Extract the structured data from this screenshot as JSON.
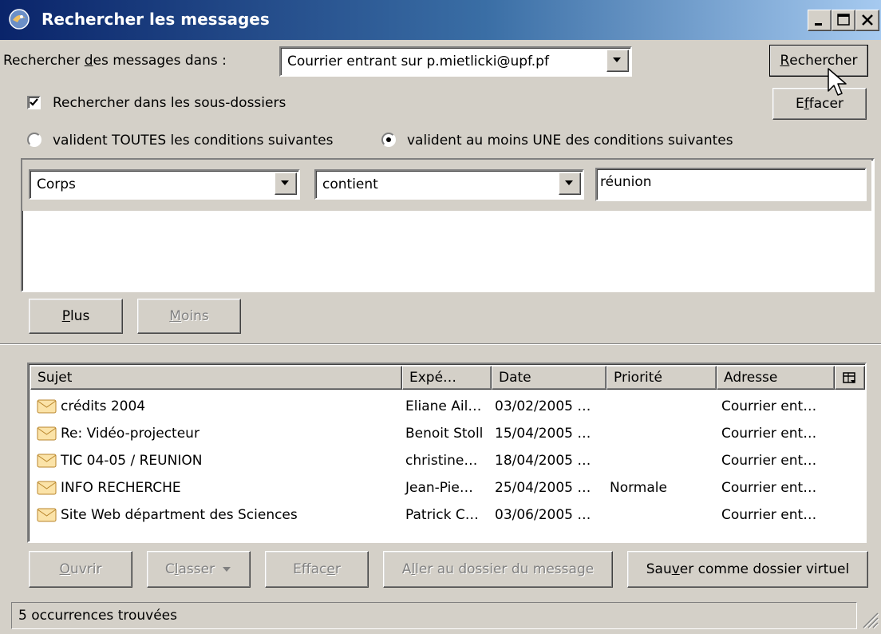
{
  "window": {
    "title": "Rechercher les messages",
    "icon": "thunderbird-icon"
  },
  "search": {
    "folder_label_before": "Rechercher ",
    "folder_label_mnemonic": "d",
    "folder_label_after": "es messages dans :",
    "folder_value": "Courrier entrant sur p.mietlicki@upf.pf",
    "search_button_before": "",
    "search_button_mnemonic": "R",
    "search_button_after": "echercher",
    "clear_button_before": "E",
    "clear_button_mnemonic": "f",
    "clear_button_after": "facer",
    "subfolders_label": "Rechercher dans les sous-dossiers",
    "subfolders_checked": true,
    "match_all_label": "valident TOUTES les conditions suivantes",
    "match_any_label": "valident au moins UNE des conditions suivantes",
    "selected_match": "any"
  },
  "criteria": {
    "field": "Corps",
    "operator": "contient",
    "value": "réunion",
    "more_mnemonic": "P",
    "more_rest": "lus",
    "less_mnemonic": "M",
    "less_rest": "oins"
  },
  "results": {
    "columns": [
      "Sujet",
      "Expé…",
      "Date",
      "Priorité",
      "Adresse"
    ],
    "rows": [
      {
        "subject": "crédits 2004",
        "sender": "Eliane Ail…",
        "date": "03/02/2005 …",
        "priority": "",
        "account": "Courrier ent…"
      },
      {
        "subject": "Re: Vidéo-projecteur",
        "sender": "Benoit Stoll",
        "date": "15/04/2005 …",
        "priority": "",
        "account": "Courrier ent…"
      },
      {
        "subject": "TIC 04-05 / REUNION",
        "sender": "christine…",
        "date": "18/04/2005 …",
        "priority": "",
        "account": "Courrier ent…"
      },
      {
        "subject": "INFO RECHERCHE",
        "sender": "Jean-Pie…",
        "date": "25/04/2005 …",
        "priority": "Normale",
        "account": "Courrier ent…"
      },
      {
        "subject": "Site Web départment des Sciences",
        "sender": "Patrick C…",
        "date": "03/06/2005 …",
        "priority": "",
        "account": "Courrier ent…"
      }
    ]
  },
  "actions": {
    "open_mnemonic": "O",
    "open_rest": "uvrir",
    "file_before": "C",
    "file_mnemonic": "l",
    "file_after": "asser",
    "delete_before": "Effac",
    "delete_mnemonic": "e",
    "delete_after": "r",
    "goto_before": "A",
    "goto_mnemonic": "l",
    "goto_after": "ler au dossier du message",
    "save_before": "Sau",
    "save_mnemonic": "v",
    "save_after": "er comme dossier virtuel"
  },
  "status": {
    "text": "5 occurrences trouvées"
  },
  "colors": {
    "title_start": "#0a246a",
    "title_end": "#a6caf0",
    "face": "#d4d0c8"
  }
}
